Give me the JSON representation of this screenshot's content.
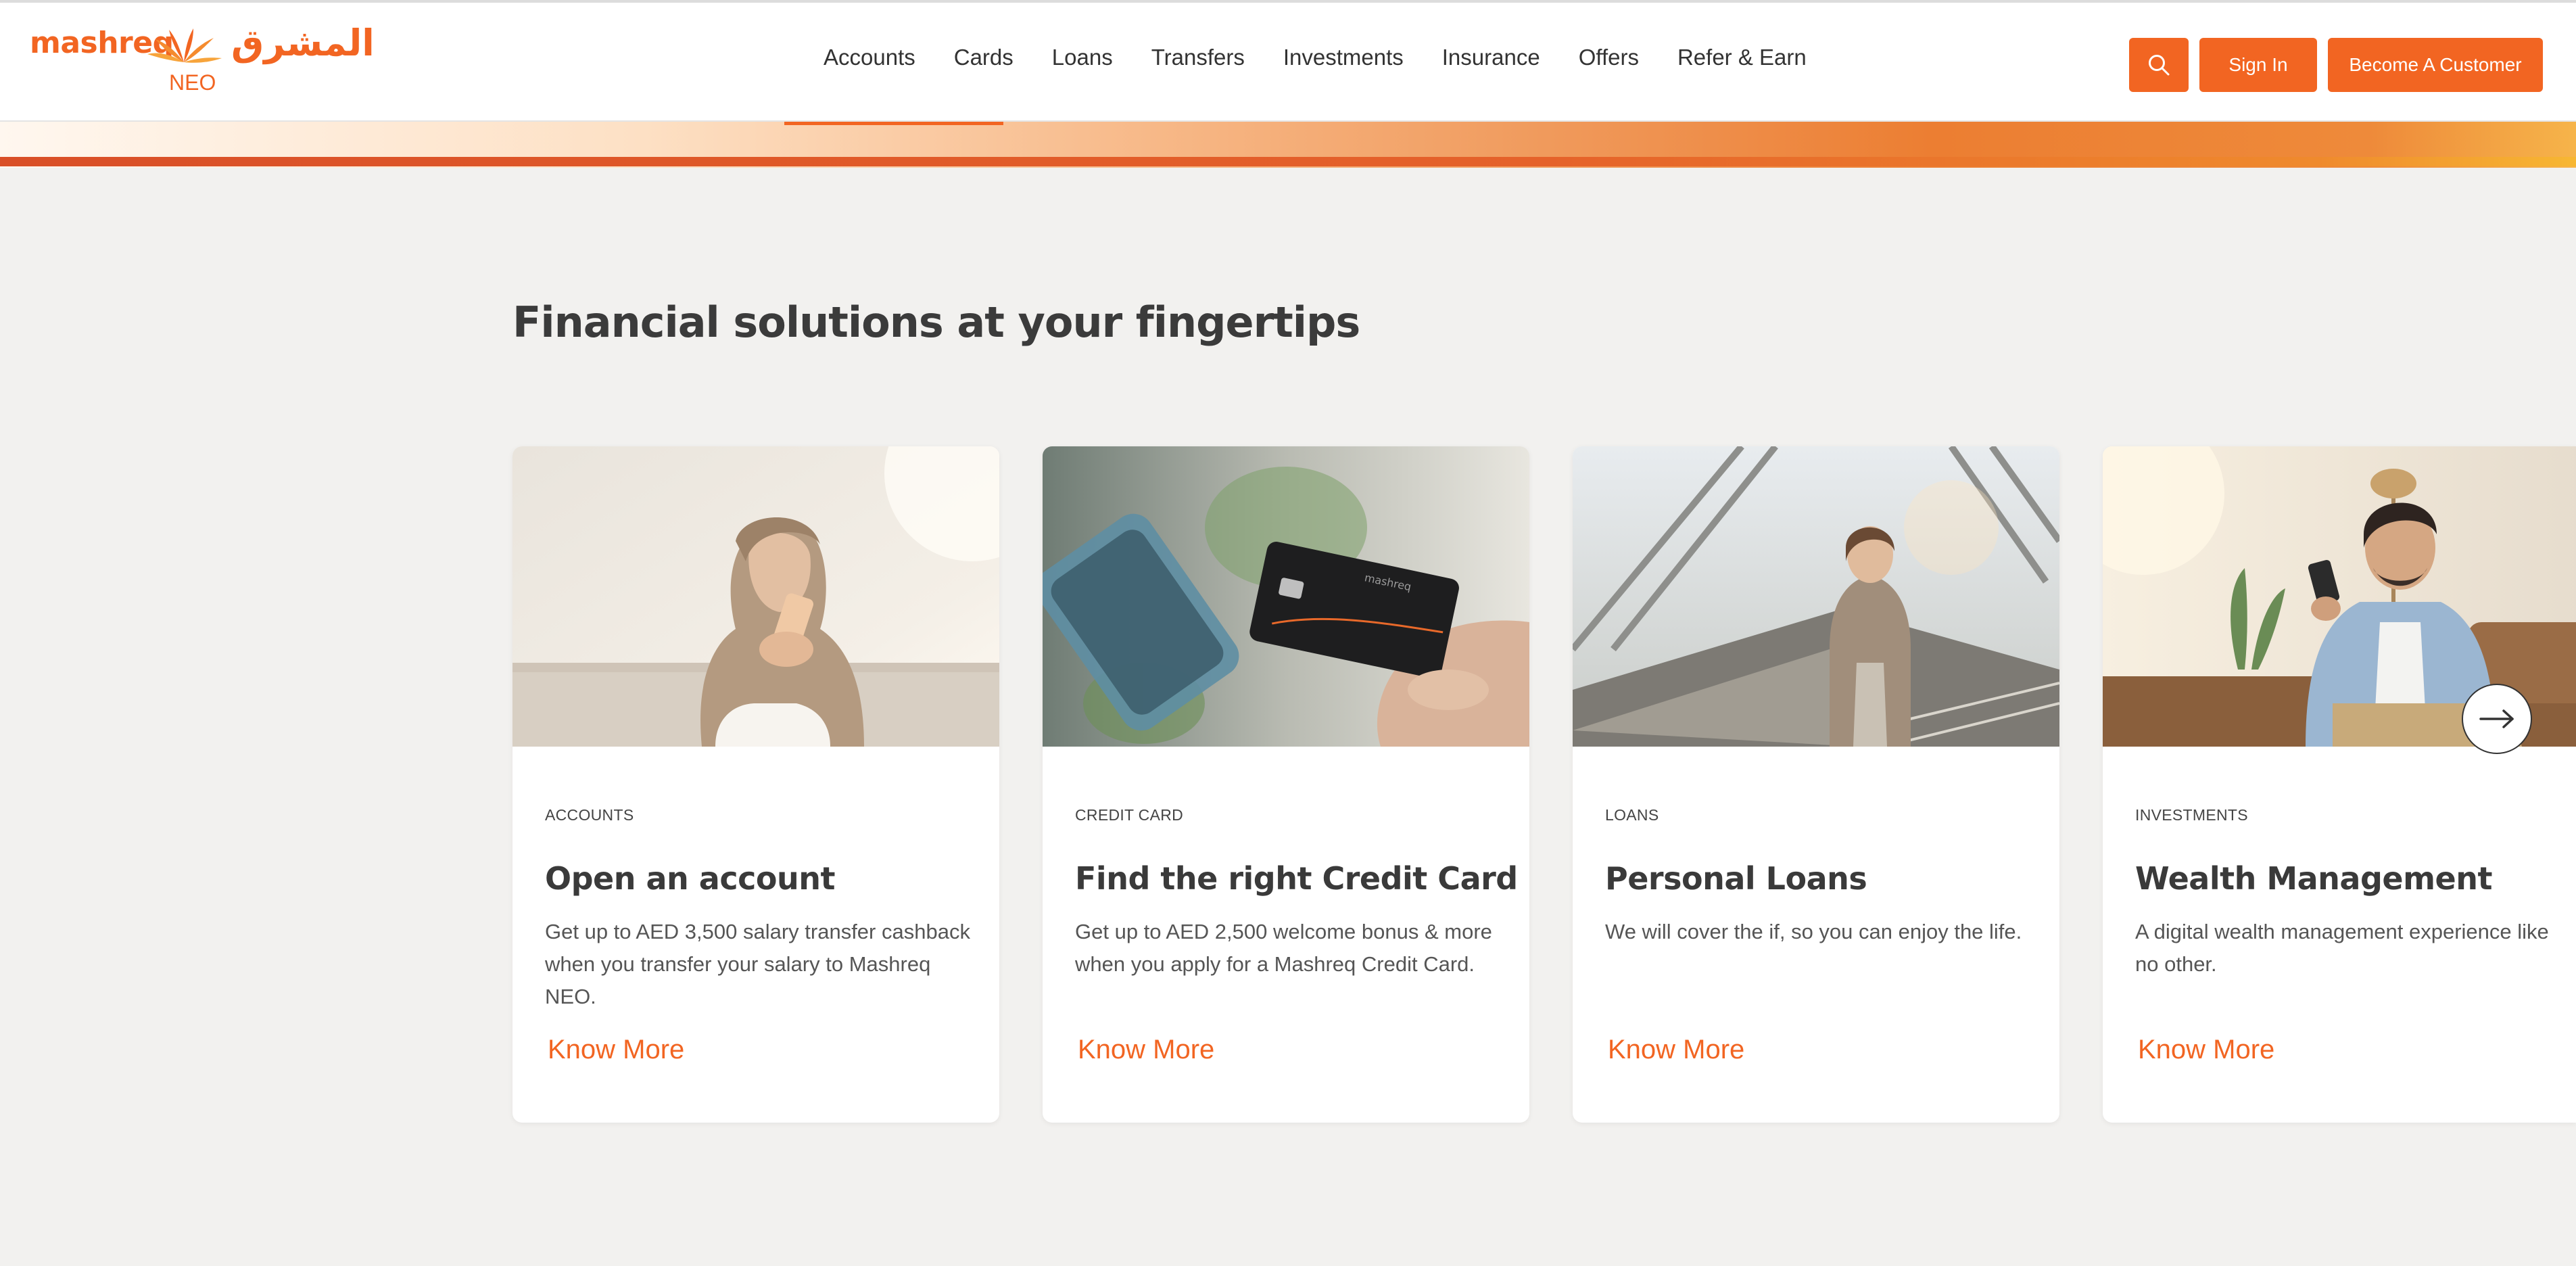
{
  "brand": {
    "name_latin": "mashreq",
    "name_arabic": "المشرق",
    "sub": "NEO",
    "accent_color": "#f26522",
    "logo_icon": "sunburst-logo-icon"
  },
  "nav": {
    "items": [
      {
        "label": "Accounts"
      },
      {
        "label": "Cards"
      },
      {
        "label": "Loans"
      },
      {
        "label": "Transfers"
      },
      {
        "label": "Investments"
      },
      {
        "label": "Insurance"
      },
      {
        "label": "Offers"
      },
      {
        "label": "Refer & Earn"
      }
    ]
  },
  "header_actions": {
    "search_icon": "search-icon",
    "sign_in": "Sign In",
    "become_customer": "Become A Customer"
  },
  "main": {
    "title": "Financial solutions at your fingertips",
    "cards": [
      {
        "eyebrow": "ACCOUNTS",
        "title": "Open an account",
        "desc": "Get up to AED 3,500 salary transfer cashback when you transfer your salary to Mashreq NEO.",
        "link": "Know More",
        "image": "woman-in-hijab-with-phone"
      },
      {
        "eyebrow": "CREDIT CARD",
        "title": "Find the right Credit Card",
        "desc": "Get up to AED 2,500 welcome bonus & more when you apply for a Mashreq Credit Card.",
        "link": "Know More",
        "image": "hands-holding-phone-and-credit-card"
      },
      {
        "eyebrow": "LOANS",
        "title": "Personal Loans",
        "desc": "We will cover the if, so you can enjoy the life.",
        "link": "Know More",
        "image": "woman-on-escalator-with-coffee"
      },
      {
        "eyebrow": "INVESTMENTS",
        "title": "Wealth Management",
        "desc": "A digital wealth management experience like no other.",
        "link": "Know More",
        "image": "smiling-man-on-sofa-with-phone"
      }
    ],
    "carousel_next_icon": "arrow-right-icon"
  }
}
